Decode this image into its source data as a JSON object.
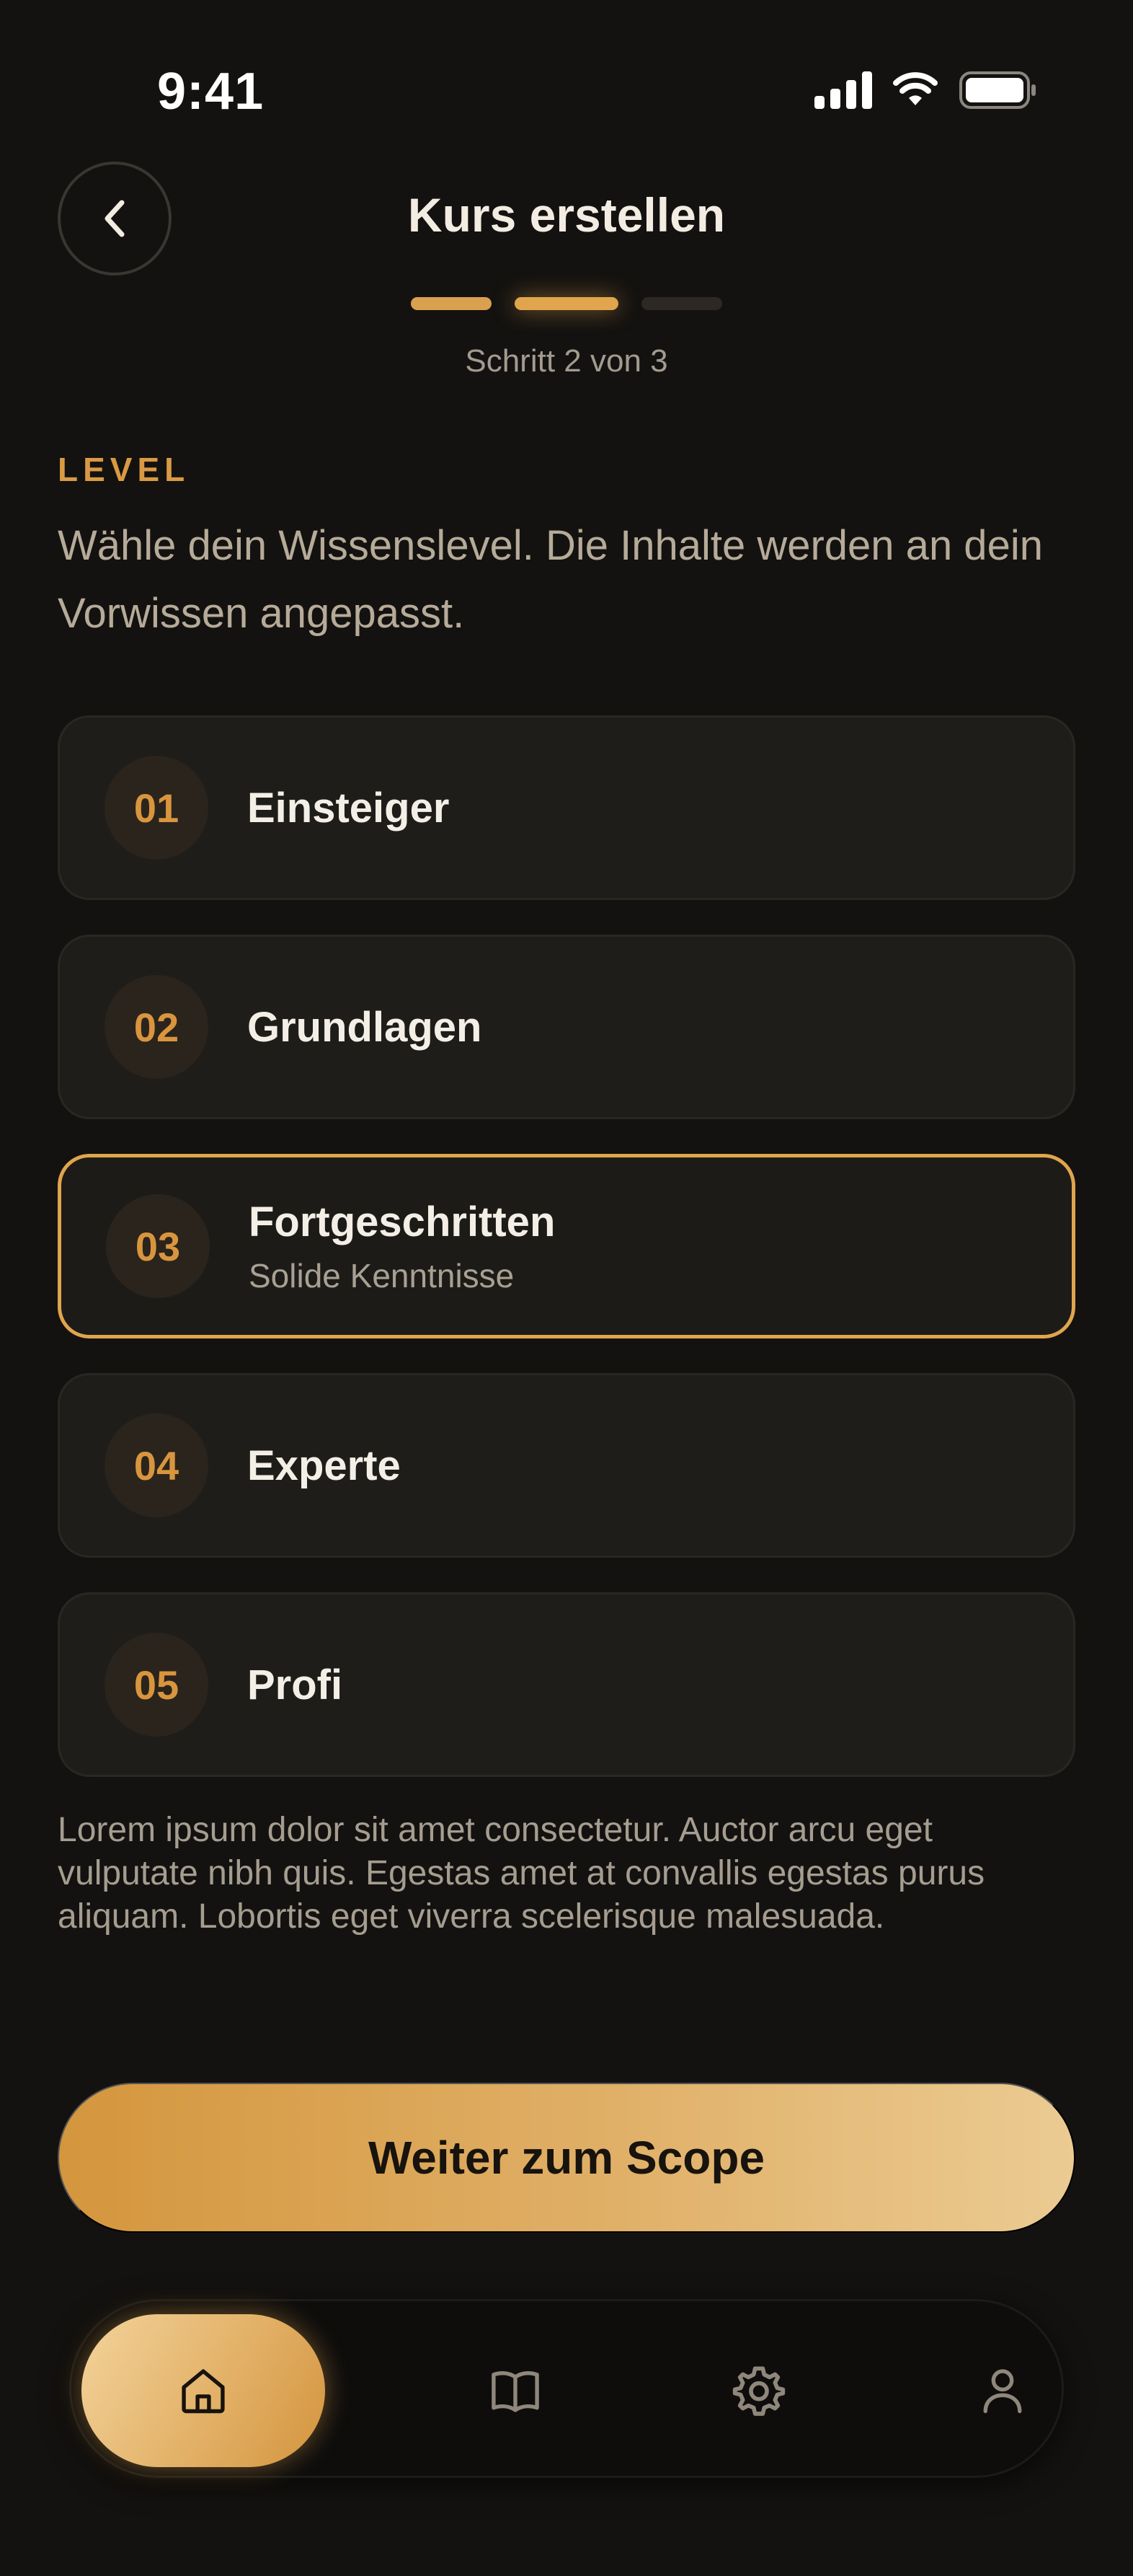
{
  "status_bar": {
    "time": "9:41"
  },
  "header": {
    "title": "Kurs erstellen"
  },
  "stepper": {
    "label": "Schritt 2 von 3",
    "current": 2,
    "total": 3
  },
  "section": {
    "label": "LEVEL",
    "description": "Wähle dein Wissenslevel. Die Inhalte werden an dein Vorwissen angepasst."
  },
  "levels": [
    {
      "num": "01",
      "title": "Einsteiger"
    },
    {
      "num": "02",
      "title": "Grundlagen"
    },
    {
      "num": "03",
      "title": "Fortgeschritten",
      "subtitle": "Solide Kenntnisse",
      "selected": true
    },
    {
      "num": "04",
      "title": "Experte"
    },
    {
      "num": "05",
      "title": "Profi"
    }
  ],
  "body_text": "Lorem ipsum dolor sit amet consectetur. Auctor arcu eget vulputate nibh quis. Egestas amet at convallis egestas purus aliquam. Lobortis eget viverra scelerisque malesuada.",
  "cta": {
    "label": "Weiter zum Scope"
  },
  "tab_bar": {
    "items": [
      {
        "icon": "home-icon",
        "active": true
      },
      {
        "icon": "book-icon",
        "active": false
      },
      {
        "icon": "gear-icon",
        "active": false
      },
      {
        "icon": "user-icon",
        "active": false
      }
    ]
  },
  "colors": {
    "accent": "#e0a54d",
    "background": "#141210",
    "card": "#1f1d1a"
  }
}
